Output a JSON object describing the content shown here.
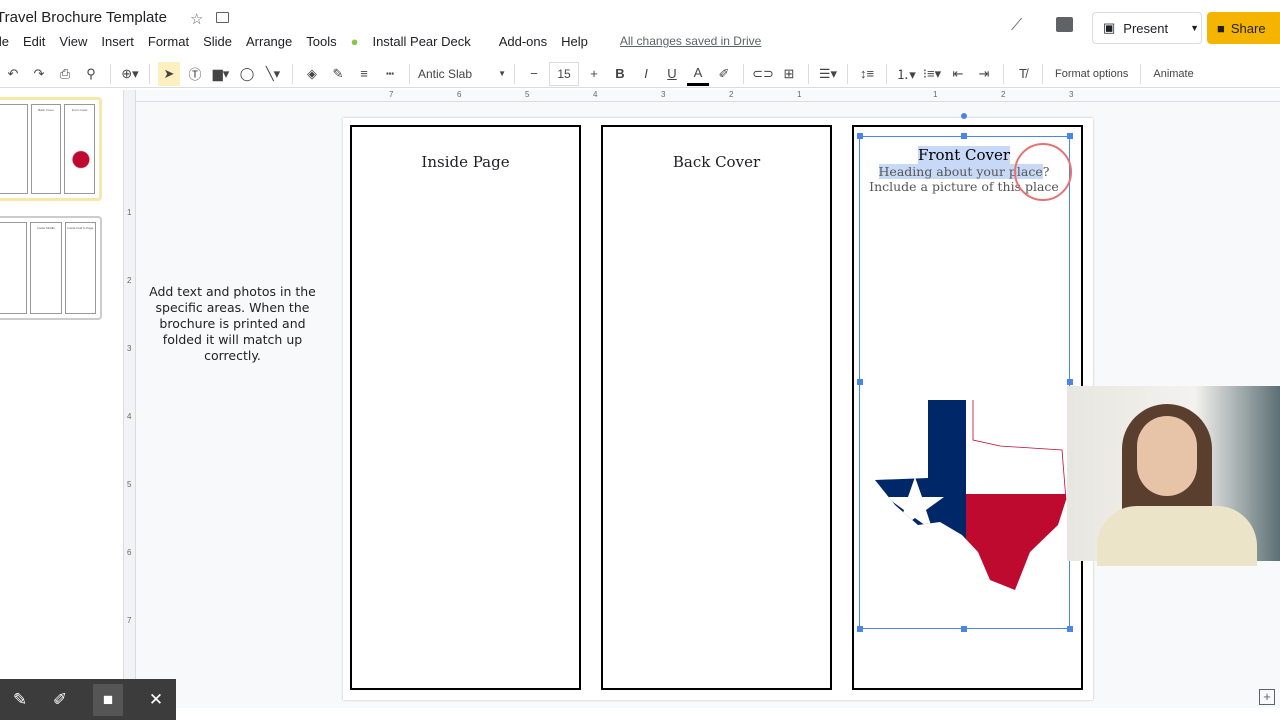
{
  "doc": {
    "title": "Travel Brochure Template",
    "saved_status": "All changes saved in Drive"
  },
  "menu": [
    "ile",
    "Edit",
    "View",
    "Insert",
    "Format",
    "Slide",
    "Arrange",
    "Tools",
    "Install Pear Deck",
    "Add-ons",
    "Help"
  ],
  "header": {
    "present_label": "Present",
    "share_label": "Share"
  },
  "toolbar": {
    "font": "Antic Slab",
    "font_size": "15",
    "format_options": "Format options",
    "animate": "Animate"
  },
  "thumbnails": [
    {
      "panels": [
        "",
        "Back Cover",
        "Front Cover"
      ]
    },
    {
      "panels": [
        "",
        "Inside Middle",
        "Inside Fold In Page"
      ]
    }
  ],
  "vruler_labels": [
    "1",
    "2",
    "3",
    "4",
    "5",
    "6",
    "7"
  ],
  "hruler_labels": [
    "7",
    "6",
    "5",
    "4",
    "3",
    "2",
    "1",
    "1",
    "2",
    "3"
  ],
  "slide": {
    "note": "Add text and photos in the specific areas. When the brochure is printed and folded it will match up correctly.",
    "panels": [
      "Inside Page",
      "Back Cover",
      "Front Cover"
    ],
    "front_heading": "Heading about your place",
    "front_heading_suffix": "?",
    "front_sub": "Include a picture of this place"
  },
  "colors": {
    "accent": "#4a86e8",
    "share": "#f4b400",
    "flag_blue": "#002868",
    "flag_red": "#bf0a30"
  }
}
